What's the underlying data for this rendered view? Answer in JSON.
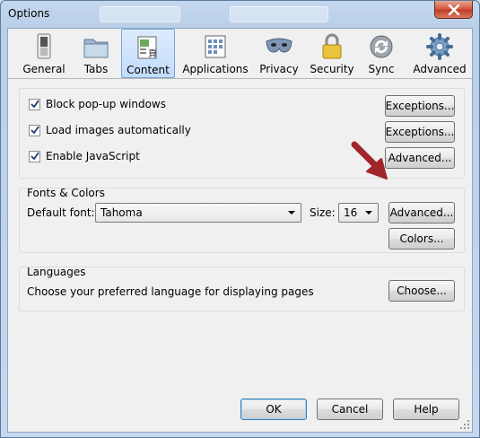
{
  "window": {
    "title": "Options"
  },
  "tabs": [
    {
      "label": "General",
      "icon": "switch-icon"
    },
    {
      "label": "Tabs",
      "icon": "tabs-folder-icon"
    },
    {
      "label": "Content",
      "icon": "content-page-icon"
    },
    {
      "label": "Applications",
      "icon": "applications-icon"
    },
    {
      "label": "Privacy",
      "icon": "mask-icon"
    },
    {
      "label": "Security",
      "icon": "padlock-icon"
    },
    {
      "label": "Sync",
      "icon": "sync-icon"
    },
    {
      "label": "Advanced",
      "icon": "gear-icon"
    }
  ],
  "active_tab": "Content",
  "content_options": {
    "block_popups": {
      "label": "Block pop-up windows",
      "checked": true,
      "button": "Exceptions..."
    },
    "load_images": {
      "label": "Load images automatically",
      "checked": true,
      "button": "Exceptions..."
    },
    "enable_js": {
      "label": "Enable JavaScript",
      "checked": true,
      "button": "Advanced..."
    }
  },
  "fonts_colors": {
    "title": "Fonts & Colors",
    "default_font_label": "Default font:",
    "default_font_value": "Tahoma",
    "size_label": "Size:",
    "size_value": "16",
    "advanced_button": "Advanced...",
    "colors_button": "Colors..."
  },
  "languages": {
    "title": "Languages",
    "description": "Choose your preferred language for displaying pages",
    "choose_button": "Choose..."
  },
  "footer": {
    "ok": "OK",
    "cancel": "Cancel",
    "help": "Help"
  },
  "colors": {
    "accent": "#3c7fb1",
    "annotation_arrow": "#a0262b"
  }
}
